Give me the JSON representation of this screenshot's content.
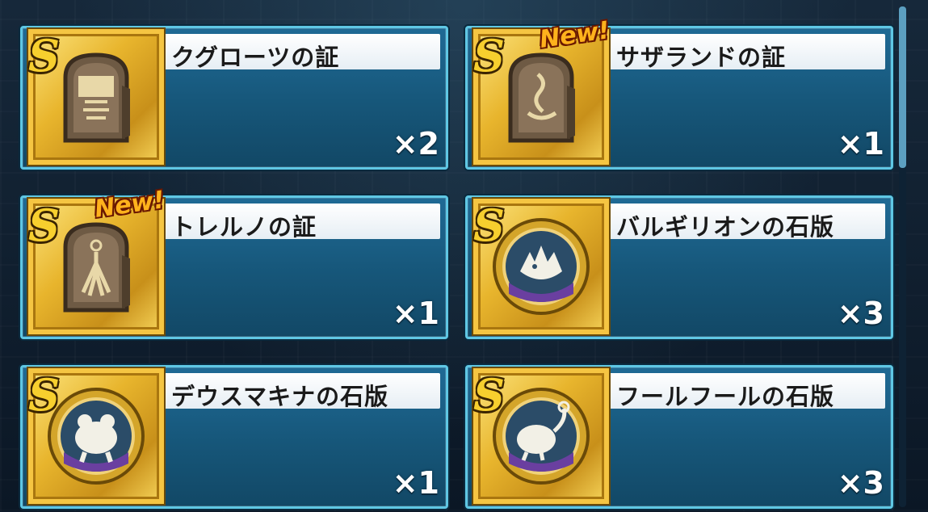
{
  "items": [
    {
      "name": "クグローツの証",
      "count": "×2",
      "rank": "S",
      "new": "",
      "kind": "tablet"
    },
    {
      "name": "サザランドの証",
      "count": "×1",
      "rank": "S",
      "new": "New!",
      "kind": "tablet"
    },
    {
      "name": "トレルノの証",
      "count": "×1",
      "rank": "S",
      "new": "New!",
      "kind": "tablet"
    },
    {
      "name": "バルギリオンの石版",
      "count": "×3",
      "rank": "S",
      "new": "",
      "kind": "medallion"
    },
    {
      "name": "デウスマキナの石版",
      "count": "×1",
      "rank": "S",
      "new": "",
      "kind": "medallion"
    },
    {
      "name": "フールフールの石版",
      "count": "×3",
      "rank": "S",
      "new": "",
      "kind": "medallion"
    }
  ],
  "icons": {
    "tablet": "stone-tablet-icon",
    "medallion": "stone-medallion-icon"
  },
  "colors": {
    "panel": "#1f6a95",
    "panel_border": "#5fc7e4",
    "gold": "#f5c542",
    "new_badge": "#ffb21c"
  }
}
